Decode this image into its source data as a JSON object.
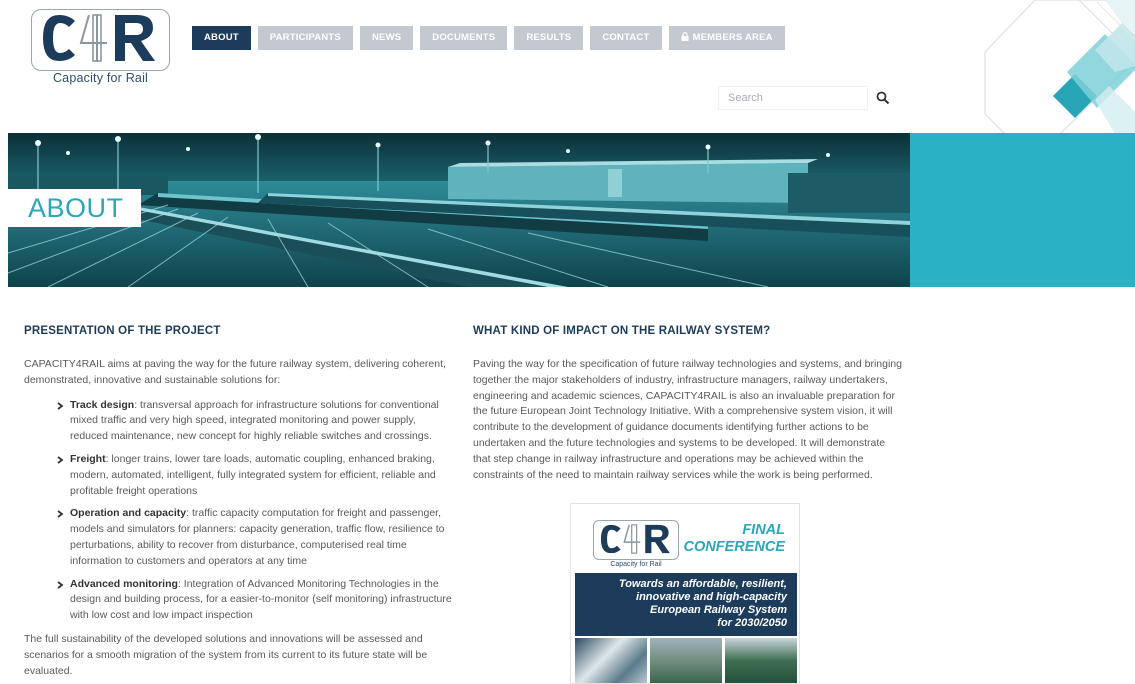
{
  "brand": {
    "tagline": "Capacity for Rail",
    "navy": "#1d3c5c",
    "teal": "#2aa7b8",
    "grey_nav": "#c3c9cf"
  },
  "nav": {
    "items": [
      {
        "label": "ABOUT",
        "active": true
      },
      {
        "label": "PARTICIPANTS",
        "active": false
      },
      {
        "label": "NEWS",
        "active": false
      },
      {
        "label": "DOCUMENTS",
        "active": false
      },
      {
        "label": "RESULTS",
        "active": false
      },
      {
        "label": "CONTACT",
        "active": false
      },
      {
        "label": "MEMBERS AREA",
        "active": false,
        "icon": "lock-icon"
      }
    ]
  },
  "search": {
    "placeholder": "Search",
    "icon": "search-icon"
  },
  "banner": {
    "title": "ABOUT"
  },
  "presentation": {
    "heading": "PRESENTATION OF THE PROJECT",
    "intro": "CAPACITY4RAIL aims at paving the way for the future railway system, delivering coherent, demonstrated, innovative and sustainable solutions for:",
    "bullets": [
      {
        "term": "Track design",
        "text": ": transversal approach for infrastructure solutions for conventional mixed traffic and very high speed, integrated monitoring and power supply, reduced maintenance, new concept for highly reliable switches and crossings."
      },
      {
        "term": "Freight",
        "text": ": longer trains, lower tare loads, automatic coupling, enhanced braking, modern, automated, intelligent, fully integrated system for efficient, reliable and profitable freight operations"
      },
      {
        "term": "Operation and capacity",
        "text": ": traffic capacity computation for freight and passenger, models and simulators for planners: capacity generation, traffic flow, resilience to perturbations, ability to recover from disturbance, computerised real time information to customers and operators at any time"
      },
      {
        "term": "Advanced monitoring",
        "text": ": Integration of Advanced Monitoring Technologies in the design and building process, for a easier-to-monitor (self monitoring) infrastructure with low cost and low impact inspection"
      }
    ],
    "outro": "The full sustainability of the developed solutions and innovations will be assessed and scenarios for a smooth migration of the system from its current to its future state will be evaluated."
  },
  "impact": {
    "heading": "WHAT KIND OF IMPACT ON THE RAILWAY SYSTEM?",
    "body": "Paving the way for the specification of future railway technologies and systems, and bringing together the major stakeholders of industry, infrastructure managers, railway undertakers, engineering and academic sciences, CAPACITY4RAIL is also an invaluable preparation for the future European Joint Technology Initiative. With a comprehensive system vision, it will contribute to the development of guidance documents identifying further actions to be undertaken and the future technologies and systems to be developed. It will demonstrate that step change in railway infrastructure and operations may be achieved within the constraints of the need to maintain railway services while the work is being performed."
  },
  "poster": {
    "logo_tagline": "Capacity for Rail",
    "title_line1": "FINAL",
    "title_line2": "CONFERENCE",
    "band_lines": [
      "Towards an affordable, resilient,",
      "innovative and high-capacity",
      "European Railway System",
      "for 2030/2050"
    ]
  }
}
